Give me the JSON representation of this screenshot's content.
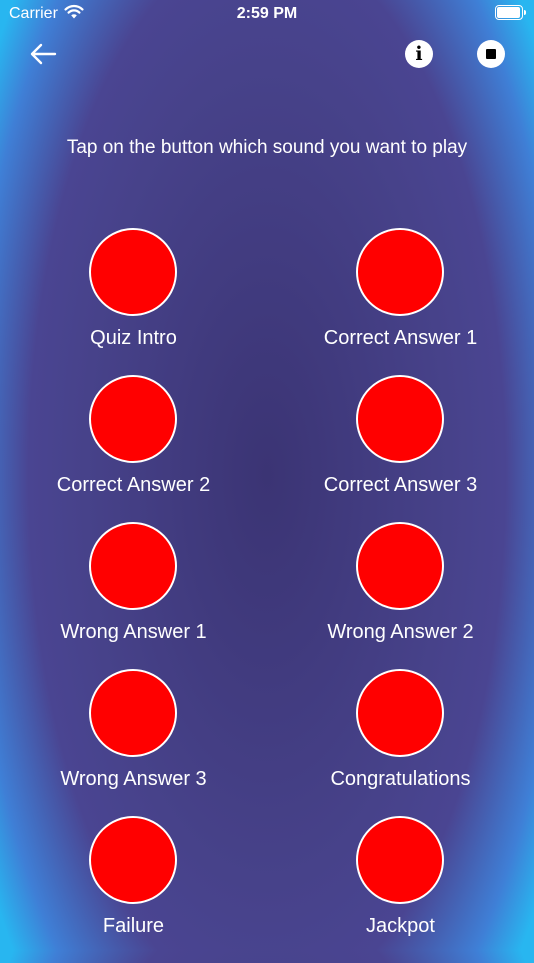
{
  "status_bar": {
    "carrier": "Carrier",
    "time": "2:59 PM"
  },
  "nav": {
    "back_icon": "arrow-left-icon",
    "info_icon": "info-icon",
    "info_glyph": "i",
    "stop_icon": "stop-icon"
  },
  "instruction": "Tap on the button which sound you want to play",
  "sounds": [
    {
      "label": "Quiz Intro"
    },
    {
      "label": "Correct Answer 1"
    },
    {
      "label": "Correct Answer 2"
    },
    {
      "label": "Correct Answer 3"
    },
    {
      "label": "Wrong Answer 1"
    },
    {
      "label": "Wrong Answer 2"
    },
    {
      "label": "Wrong Answer 3"
    },
    {
      "label": "Congratulations"
    },
    {
      "label": "Failure"
    },
    {
      "label": "Jackpot"
    }
  ],
  "colors": {
    "button": "#ff0000",
    "background_center": "#3b3474",
    "background_edge": "#28b6f0"
  }
}
